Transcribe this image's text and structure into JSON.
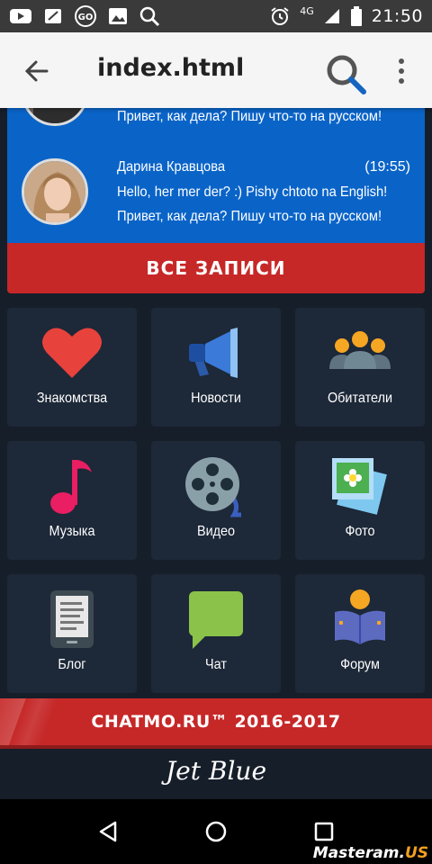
{
  "status_bar": {
    "time": "21:50",
    "network": "4G",
    "icons": [
      "youtube-icon",
      "cast-icon",
      "go-icon",
      "image-icon",
      "search-icon",
      "alarm-icon",
      "signal-icon",
      "battery-icon"
    ]
  },
  "app_bar": {
    "title": "index.html"
  },
  "messages": [
    {
      "author": "",
      "time": "",
      "line1": "Привет, как дела? Пишу что-то на русском!",
      "line2": ""
    },
    {
      "author": "Дарина Кравцова",
      "time": "(19:55)",
      "line1": "Hello, her mer der? :) Pishy chtoto na English!",
      "line2": "Привет, как дела? Пишу что-то на русском!"
    }
  ],
  "all_posts_label": "ВСЕ ЗАПИСИ",
  "tiles": [
    {
      "label": "Знакомства",
      "icon": "heart-icon"
    },
    {
      "label": "Новости",
      "icon": "megaphone-icon"
    },
    {
      "label": "Обитатели",
      "icon": "people-icon"
    },
    {
      "label": "Музыка",
      "icon": "music-note-icon"
    },
    {
      "label": "Видео",
      "icon": "film-reel-icon"
    },
    {
      "label": "Фото",
      "icon": "photo-icon"
    },
    {
      "label": "Блог",
      "icon": "ebook-icon"
    },
    {
      "label": "Чат",
      "icon": "chat-bubble-icon"
    },
    {
      "label": "Форум",
      "icon": "reader-icon"
    }
  ],
  "footer_text": "CHATMO.RU™ 2016-2017",
  "brand": "Jet Blue",
  "watermark": {
    "main": "Masteram.",
    "suffix": "US"
  },
  "colors": {
    "accent_red": "#c62828",
    "chat_blue": "#0a64c8",
    "background": "#161e29",
    "tile": "#1d2838"
  }
}
